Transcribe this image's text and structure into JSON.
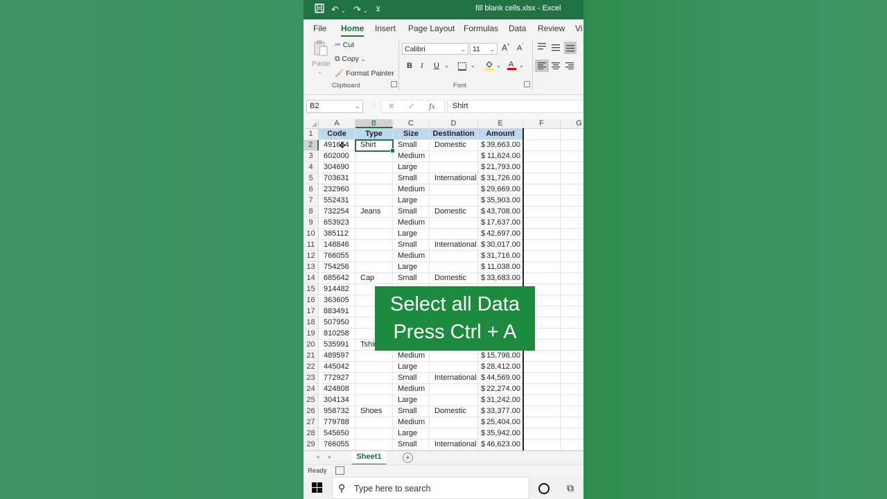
{
  "window": {
    "title": "fill blank cells.xlsx  -  Excel"
  },
  "quick_access": {
    "save_icon": "save-icon",
    "undo_icon": "undo-icon",
    "redo_icon": "redo-icon",
    "customize_icon": "customize-icon"
  },
  "ribbon_tabs": [
    "File",
    "Home",
    "Insert",
    "Page Layout",
    "Formulas",
    "Data",
    "Review",
    "Vi"
  ],
  "clipboard": {
    "paste": "Paste",
    "cut": "Cut",
    "copy": "Copy",
    "format_painter": "Format Painter",
    "group": "Clipboard"
  },
  "font": {
    "name": "Calibri",
    "size": "11",
    "group": "Font",
    "bold": "B",
    "italic": "I",
    "underline": "U"
  },
  "formula_bar": {
    "name_box": "B2",
    "value": "Shirt",
    "fx": "fx"
  },
  "columns": [
    "A",
    "B",
    "C",
    "D",
    "E",
    "F",
    "G"
  ],
  "headers": [
    "Code",
    "Type",
    "Size",
    "Destination",
    "Amount"
  ],
  "rows": [
    {
      "n": "2",
      "code": "491654",
      "type": "Shirt",
      "size": "Small",
      "dest": "Domestic",
      "amt": "39,663.00"
    },
    {
      "n": "3",
      "code": "602000",
      "type": "",
      "size": "Medium",
      "dest": "",
      "amt": "11,624.00"
    },
    {
      "n": "4",
      "code": "304690",
      "type": "",
      "size": "Large",
      "dest": "",
      "amt": "21,793.00"
    },
    {
      "n": "5",
      "code": "703631",
      "type": "",
      "size": "Small",
      "dest": "International",
      "amt": "31,726.00"
    },
    {
      "n": "6",
      "code": "232960",
      "type": "",
      "size": "Medium",
      "dest": "",
      "amt": "29,669.00"
    },
    {
      "n": "7",
      "code": "552431",
      "type": "",
      "size": "Large",
      "dest": "",
      "amt": "35,903.00"
    },
    {
      "n": "8",
      "code": "732254",
      "type": "Jeans",
      "size": "Small",
      "dest": "Domestic",
      "amt": "43,708.00"
    },
    {
      "n": "9",
      "code": "653923",
      "type": "",
      "size": "Medium",
      "dest": "",
      "amt": "17,637.00"
    },
    {
      "n": "10",
      "code": "385112",
      "type": "",
      "size": "Large",
      "dest": "",
      "amt": "42,697.00"
    },
    {
      "n": "11",
      "code": "148846",
      "type": "",
      "size": "Small",
      "dest": "International",
      "amt": "30,017.00"
    },
    {
      "n": "12",
      "code": "766055",
      "type": "",
      "size": "Medium",
      "dest": "",
      "amt": "31,716.00"
    },
    {
      "n": "13",
      "code": "754256",
      "type": "",
      "size": "Large",
      "dest": "",
      "amt": "11,038.00"
    },
    {
      "n": "14",
      "code": "685642",
      "type": "Cap",
      "size": "Small",
      "dest": "Domestic",
      "amt": "33,683.00"
    },
    {
      "n": "15",
      "code": "914482",
      "type": "",
      "size": "",
      "dest": "",
      "amt": ""
    },
    {
      "n": "16",
      "code": "363605",
      "type": "",
      "size": "",
      "dest": "",
      "amt": ""
    },
    {
      "n": "17",
      "code": "883491",
      "type": "",
      "size": "",
      "dest": "",
      "amt": ""
    },
    {
      "n": "18",
      "code": "507950",
      "type": "",
      "size": "",
      "dest": "",
      "amt": ""
    },
    {
      "n": "19",
      "code": "810258",
      "type": "",
      "size": "",
      "dest": "",
      "amt": ""
    },
    {
      "n": "20",
      "code": "535991",
      "type": "Tshirt",
      "size": "",
      "dest": "",
      "amt": ""
    },
    {
      "n": "21",
      "code": "489597",
      "type": "",
      "size": "Medium",
      "dest": "",
      "amt": "15,798.00"
    },
    {
      "n": "22",
      "code": "445042",
      "type": "",
      "size": "Large",
      "dest": "",
      "amt": "28,412.00"
    },
    {
      "n": "23",
      "code": "772927",
      "type": "",
      "size": "Small",
      "dest": "International",
      "amt": "44,569.00"
    },
    {
      "n": "24",
      "code": "424808",
      "type": "",
      "size": "Medium",
      "dest": "",
      "amt": "22,274.00"
    },
    {
      "n": "25",
      "code": "304134",
      "type": "",
      "size": "Large",
      "dest": "",
      "amt": "31,242.00"
    },
    {
      "n": "26",
      "code": "958732",
      "type": "Shoes",
      "size": "Small",
      "dest": "Domestic",
      "amt": "33,377.00"
    },
    {
      "n": "27",
      "code": "779788",
      "type": "",
      "size": "Medium",
      "dest": "",
      "amt": "25,404.00"
    },
    {
      "n": "28",
      "code": "545650",
      "type": "",
      "size": "Large",
      "dest": "",
      "amt": "35,942.00"
    },
    {
      "n": "29",
      "code": "766055",
      "type": "",
      "size": "Small",
      "dest": "International",
      "amt": "46,623.00"
    }
  ],
  "currency": "$",
  "overlay": {
    "line1": "Select all Data",
    "line2": "Press Ctrl + A"
  },
  "sheet": {
    "tab": "Sheet1"
  },
  "status": {
    "text": "Ready"
  },
  "taskbar": {
    "search_placeholder": "Type here to search"
  },
  "colors": {
    "excel_green": "#217346",
    "header_fill": "#bdd7ee",
    "overlay": "#1e8a3e"
  }
}
